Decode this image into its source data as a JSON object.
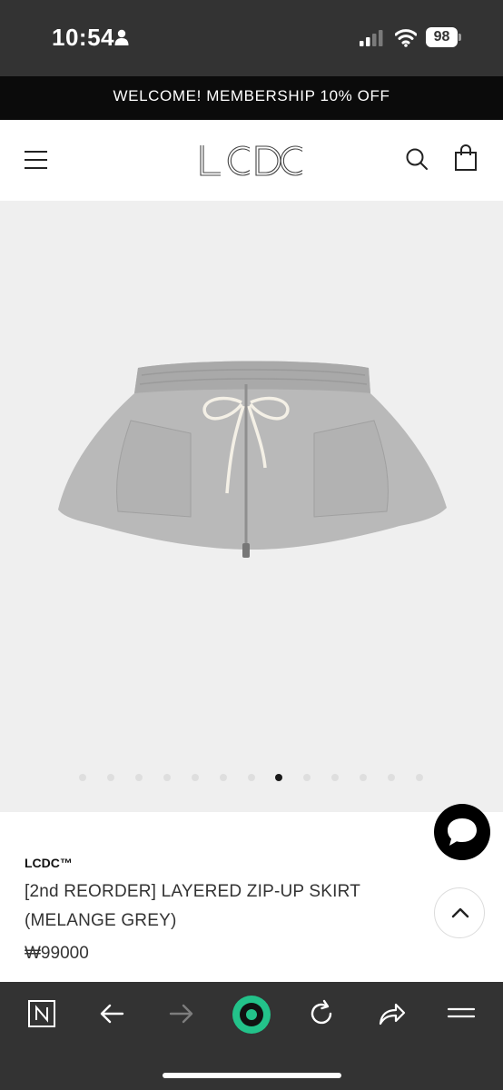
{
  "status_bar": {
    "time": "10:54",
    "battery": "98",
    "icons": [
      "person-icon",
      "signal-icon",
      "wifi-icon",
      "battery-icon"
    ]
  },
  "promo_banner": {
    "text": "WELCOME! MEMBERSHIP 10% OFF"
  },
  "header": {
    "logo_text": "LCDC",
    "icons": [
      "menu-icon",
      "search-icon",
      "shopping-bag-icon"
    ]
  },
  "gallery": {
    "image_count": 13,
    "active_index": 7,
    "image_subject": "grey sweat mini skirt with zip and drawstring"
  },
  "product": {
    "brand": "LCDC™",
    "title": "[2nd REORDER] LAYERED ZIP-UP SKIRT (MELANGE GREY)",
    "price": "₩99000"
  },
  "floating_buttons": {
    "chat_icon": "chat-bubble-icon",
    "scroll_top_icon": "chevron-up-icon"
  },
  "browser_toolbar": {
    "buttons": [
      "n-tab-icon",
      "back-arrow-icon",
      "forward-arrow-icon",
      "home-circle-icon",
      "reload-icon",
      "share-icon",
      "menu-lines-icon"
    ],
    "accent_color": "#23c28a"
  }
}
